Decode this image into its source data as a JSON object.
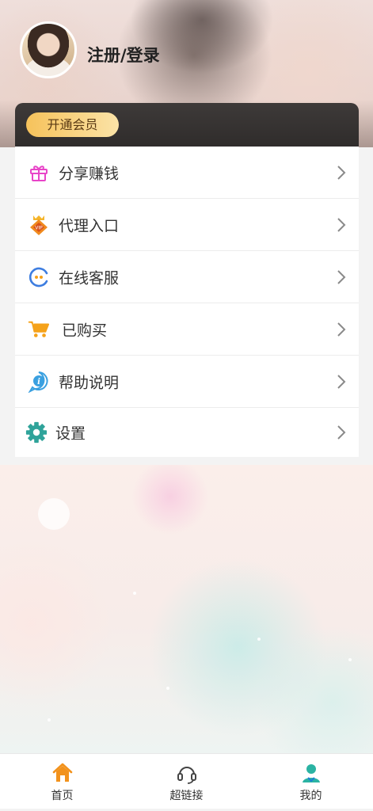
{
  "header": {
    "login_title": "注册/登录",
    "vip_button_label": "开通会员"
  },
  "menu": {
    "items": [
      {
        "label": "分享赚钱",
        "icon": "gift-icon",
        "color": "#e845c8"
      },
      {
        "label": "代理入口",
        "icon": "agent-badge-icon",
        "color": "#f08a1e"
      },
      {
        "label": "在线客服",
        "icon": "chat-service-icon",
        "color": "#3d7de0"
      },
      {
        "label": "已购买",
        "icon": "cart-icon",
        "color": "#f5a21a"
      },
      {
        "label": "帮助说明",
        "icon": "info-icon",
        "color": "#3aa0e0"
      },
      {
        "label": "设置",
        "icon": "gear-icon",
        "color": "#2fa39a"
      }
    ]
  },
  "tabbar": {
    "items": [
      {
        "label": "首页",
        "icon": "home-icon",
        "color": "#f2921c"
      },
      {
        "label": "超链接",
        "icon": "headset-icon",
        "color": "#444444"
      },
      {
        "label": "我的",
        "icon": "user-icon",
        "color": "#2bb3a3"
      }
    ]
  }
}
